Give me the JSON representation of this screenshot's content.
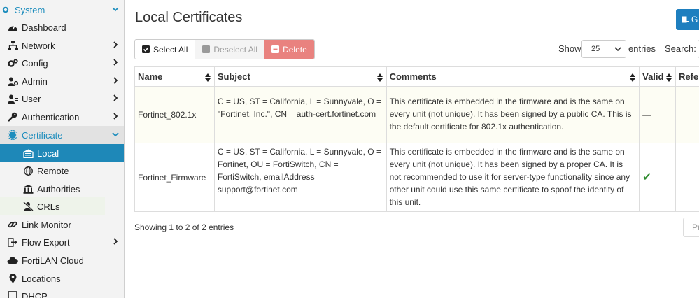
{
  "sidebar": {
    "system": "System",
    "items": [
      {
        "label": "Dashboard"
      },
      {
        "label": "Network"
      },
      {
        "label": "Config"
      },
      {
        "label": "Admin"
      },
      {
        "label": "User"
      },
      {
        "label": "Authentication"
      },
      {
        "label": "Certificate"
      },
      {
        "label": "Local"
      },
      {
        "label": "Remote"
      },
      {
        "label": "Authorities"
      },
      {
        "label": "CRLs"
      },
      {
        "label": "Link Monitor"
      },
      {
        "label": "Flow Export"
      },
      {
        "label": "FortiLAN Cloud"
      },
      {
        "label": "Locations"
      },
      {
        "label": "DHCP"
      }
    ]
  },
  "main": {
    "title": "Local Certificates",
    "top_button_label": "G",
    "toolbar": {
      "select_all": "Select All",
      "deselect_all": "Deselect All",
      "delete": "Delete"
    },
    "show_label": "Show",
    "entries_value": "25",
    "entries_label": "entries",
    "search_label": "Search:",
    "table": {
      "headers": [
        "Name",
        "Subject",
        "Comments",
        "Valid",
        "Refe"
      ],
      "rows": [
        {
          "name": "Fortinet_802.1x",
          "subject": "C = US, ST = California, L = Sunnyvale, O = \"Fortinet, Inc.\", CN = auth-cert.fortinet.com",
          "comments": "This certificate is embedded in the firmware and is the same on every unit (not unique). It has been signed by a public CA. This is the default certificate for 802.1x authentication.",
          "valid": "—"
        },
        {
          "name": "Fortinet_Firmware",
          "subject": "C = US, ST = California, L = Sunnyvale, O = Fortinet, OU = FortiSwitch, CN = FortiSwitch, emailAddress = support@fortinet.com",
          "comments": "This certificate is embedded in the firmware and is the same on every unit (not unique). It has been signed by a proper CA. It is not recommended to use it for server-type functionality since any other unit could use this same certificate to spoof the identity of this unit.",
          "valid": "✔"
        }
      ]
    },
    "showing": "Showing 1 to 2 of 2 entries",
    "prev_label": "Pr"
  },
  "colors": {
    "accent": "#1e88b8",
    "delete": "#e9827f",
    "valid_check": "#2e8b2e"
  }
}
